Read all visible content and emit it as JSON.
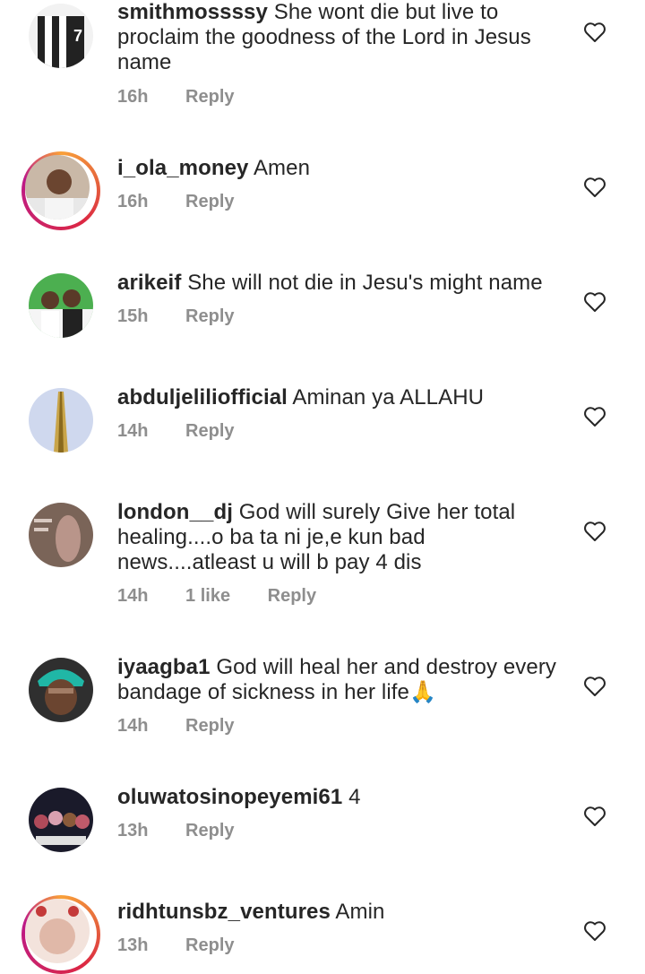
{
  "comments": [
    {
      "username": "smithmossssy",
      "text": "She wont die but live to proclaim the goodness of the Lord in Jesus name",
      "time": "16h",
      "likes": "",
      "reply": "Reply"
    },
    {
      "username": "i_ola_money",
      "text": "Amen",
      "time": "16h",
      "likes": "",
      "reply": "Reply"
    },
    {
      "username": "arikeif",
      "text": "She will not die in Jesu's might name",
      "time": "15h",
      "likes": "",
      "reply": "Reply"
    },
    {
      "username": "abduljeliliofficial",
      "text": "Aminan ya ALLAHU",
      "time": "14h",
      "likes": "",
      "reply": "Reply"
    },
    {
      "username": "london__dj",
      "text": "God will surely Give her total healing....o ba ta ni je,e kun bad news....atleast u will b pay 4 dis",
      "time": "14h",
      "likes": "1 like",
      "reply": "Reply"
    },
    {
      "username": "iyaagba1",
      "text": "God will heal her and destroy every bandage of sickness in her life🙏",
      "time": "14h",
      "likes": "",
      "reply": "Reply"
    },
    {
      "username": "oluwatosinopeyemi61",
      "text": "4",
      "time": "13h",
      "likes": "",
      "reply": "Reply"
    },
    {
      "username": "ridhtunsbz_ventures",
      "text": "Amin",
      "time": "13h",
      "likes": "",
      "reply": "Reply"
    }
  ],
  "icons": {
    "like": "heart-outline-icon"
  },
  "colors": {
    "text": "#262626",
    "meta": "#8e8e8e",
    "story_ring": "#dc2743"
  }
}
